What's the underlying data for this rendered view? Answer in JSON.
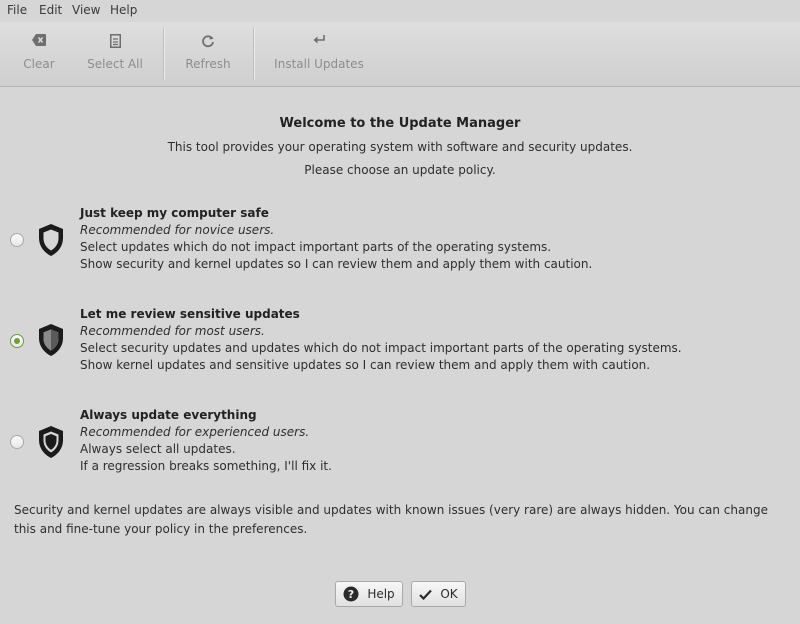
{
  "menubar": {
    "file": "File",
    "edit": "Edit",
    "view": "View",
    "help": "Help"
  },
  "toolbar": {
    "clear": {
      "label": "Clear",
      "icon": "backspace-icon"
    },
    "select_all": {
      "label": "Select All",
      "icon": "document-icon"
    },
    "refresh": {
      "label": "Refresh",
      "icon": "refresh-icon"
    },
    "install": {
      "label": "Install Updates",
      "icon": "return-icon"
    }
  },
  "welcome": {
    "title": "Welcome to the Update Manager",
    "line1": "This tool provides your operating system with software and security updates.",
    "line2": "Please choose an update policy."
  },
  "options": [
    {
      "title": "Just keep my computer safe",
      "subtitle": "Recommended for novice users.",
      "line1": "Select updates which do not impact important parts of the operating systems.",
      "line2": "Show security and kernel updates so I can review them and apply them with caution.",
      "selected": false,
      "icon": "shield-outline-icon"
    },
    {
      "title": "Let me review sensitive updates",
      "subtitle": "Recommended for most users.",
      "line1": "Select security updates and updates which do not impact important parts of the operating systems.",
      "line2": "Show kernel updates and sensitive updates so I can review them and apply them with caution.",
      "selected": true,
      "icon": "shield-half-icon"
    },
    {
      "title": "Always update everything",
      "subtitle": "Recommended for experienced users.",
      "line1": "Always select all updates.",
      "line2": "If a regression breaks something, I'll fix it.",
      "selected": false,
      "icon": "shield-full-icon"
    }
  ],
  "footer_note": "Security and kernel updates are always visible and updates with known issues (very rare) are always hidden. You can change this and fine-tune your policy in the preferences.",
  "buttons": {
    "help": "Help",
    "ok": "OK"
  },
  "colors": {
    "background": "#d6d6d6",
    "accent_green": "#6fa13b",
    "disabled_text": "#8d8d8d"
  }
}
